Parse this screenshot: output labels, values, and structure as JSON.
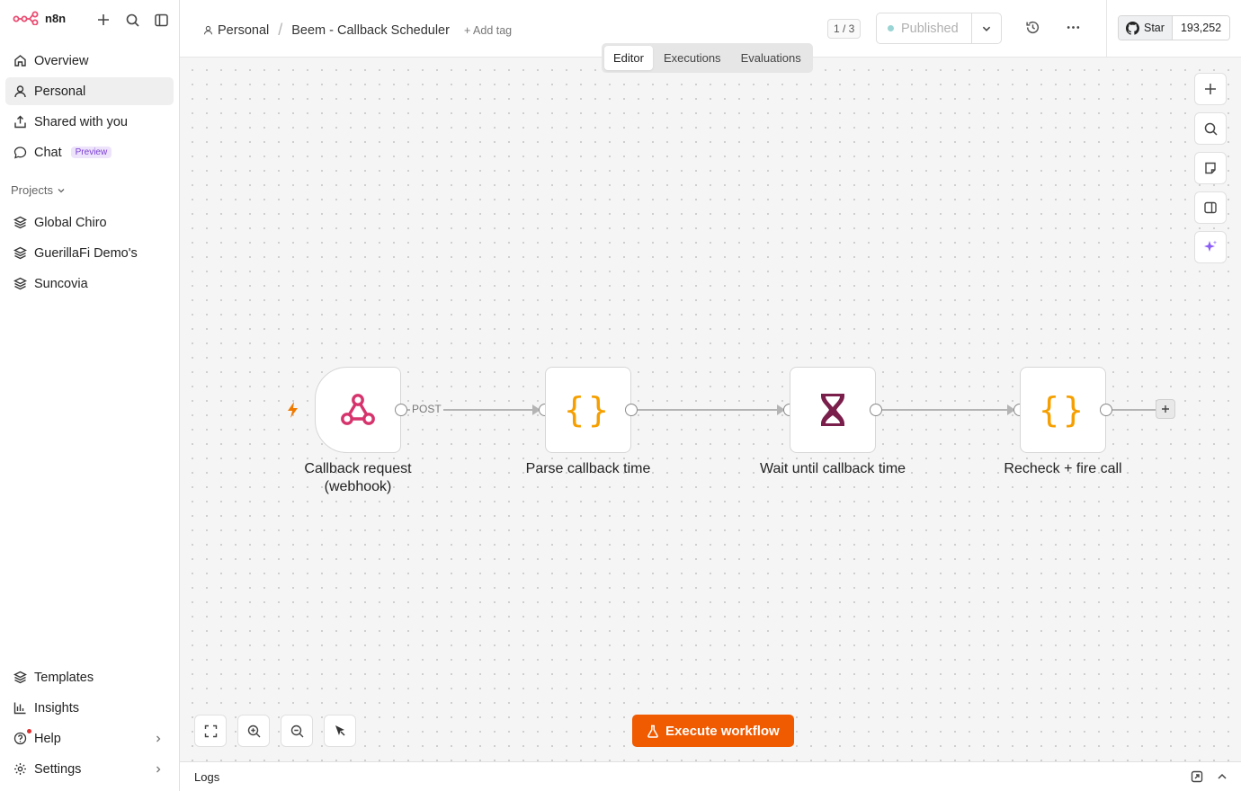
{
  "sidebar": {
    "logo_text": "n8n",
    "nav": [
      {
        "label": "Overview"
      },
      {
        "label": "Personal"
      },
      {
        "label": "Shared with you"
      },
      {
        "label": "Chat",
        "badge": "Preview"
      }
    ],
    "projects_title": "Projects",
    "projects": [
      "Global Chiro",
      "GuerillaFi Demo's",
      "Suncovia"
    ],
    "bottom": [
      "Templates",
      "Insights",
      "Help",
      "Settings"
    ]
  },
  "header": {
    "project": "Personal",
    "workflow_name": "Beem - Callback Scheduler",
    "add_tag": "+ Add tag",
    "counter": "1 / 3",
    "publish_label": "Published",
    "github_star": "Star",
    "github_count": "193,252"
  },
  "tabs": [
    "Editor",
    "Executions",
    "Evaluations"
  ],
  "workflow": {
    "nodes": [
      {
        "label_line1": "Callback request",
        "label_line2": "(webhook)",
        "icon": "webhook-icon"
      },
      {
        "label_line1": "Parse callback time",
        "icon": "code-icon"
      },
      {
        "label_line1": "Wait until callback time",
        "icon": "hourglass-icon"
      },
      {
        "label_line1": "Recheck + fire call",
        "icon": "code-icon"
      }
    ],
    "edge_label": "POST"
  },
  "execute_label": "Execute workflow",
  "logs_label": "Logs",
  "colors": {
    "accent": "#f05a00",
    "webhook": "#d6336c",
    "code": "#f59f00",
    "wait": "#7a1e4b"
  }
}
